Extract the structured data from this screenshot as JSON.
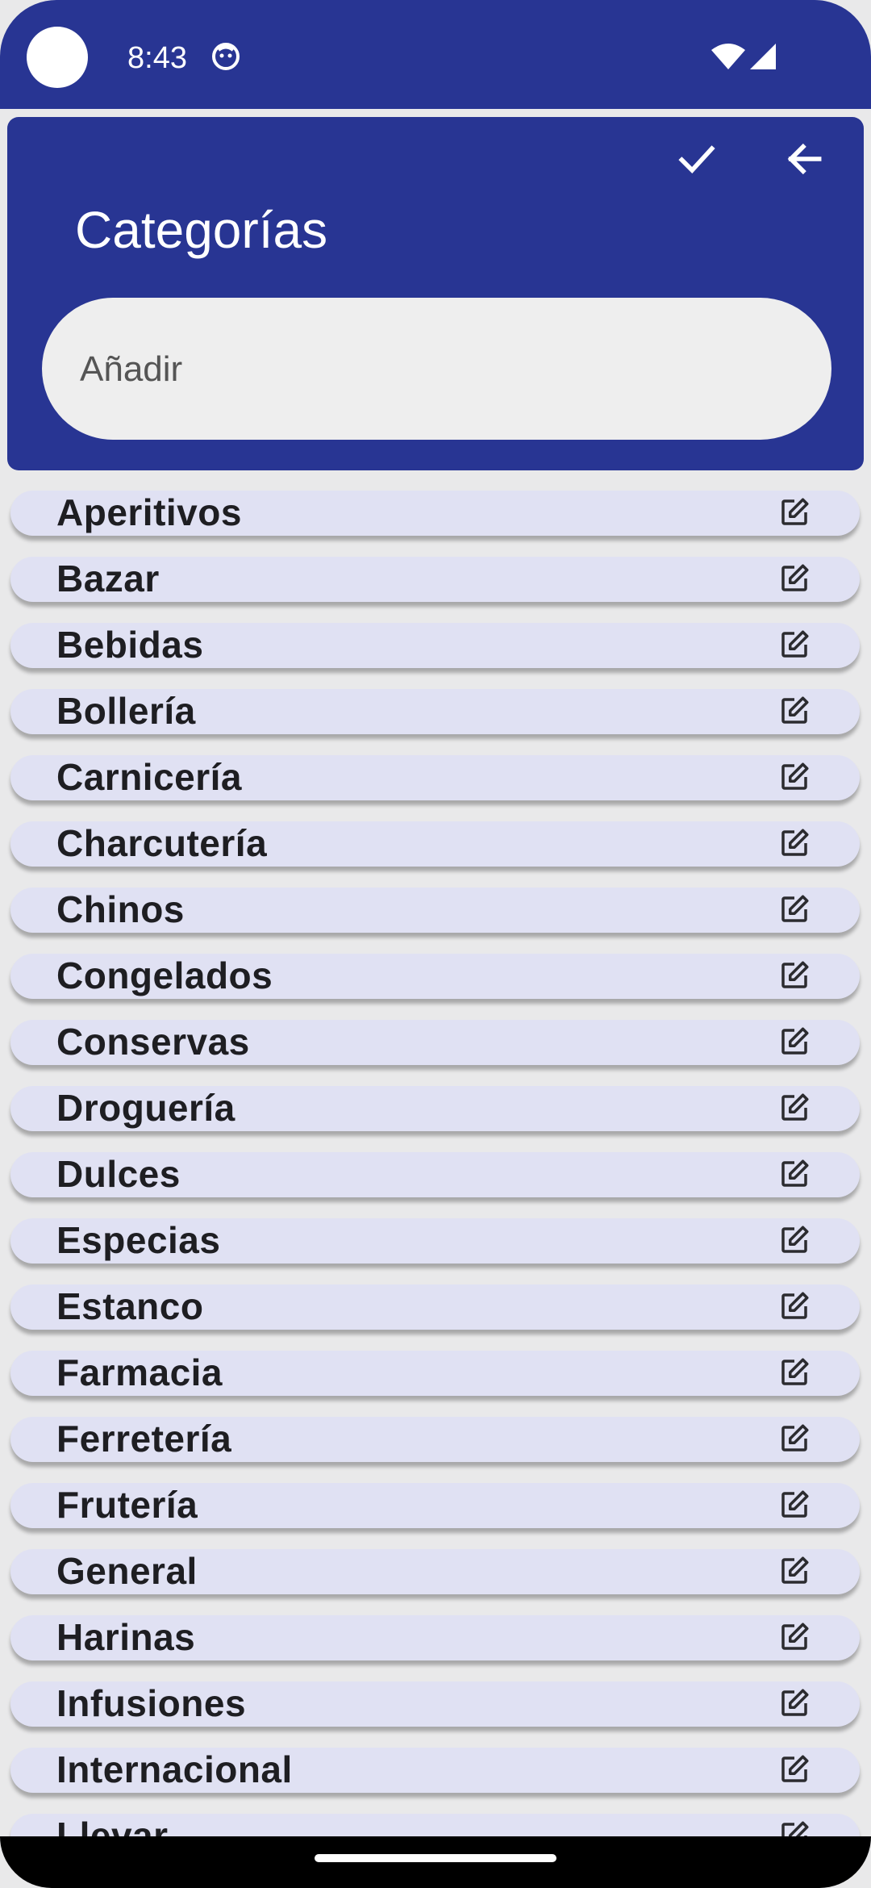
{
  "status_bar": {
    "time": "8:43"
  },
  "header": {
    "title": "Categorías",
    "confirm_icon": "check-icon",
    "back_icon": "arrow-back-icon"
  },
  "add_input": {
    "placeholder": "Añadir",
    "value": ""
  },
  "categories": [
    {
      "label": "Aperitivos"
    },
    {
      "label": "Bazar"
    },
    {
      "label": "Bebidas"
    },
    {
      "label": "Bollería"
    },
    {
      "label": "Carnicería"
    },
    {
      "label": "Charcutería"
    },
    {
      "label": "Chinos"
    },
    {
      "label": "Congelados"
    },
    {
      "label": "Conservas"
    },
    {
      "label": "Droguería"
    },
    {
      "label": "Dulces"
    },
    {
      "label": "Especias"
    },
    {
      "label": "Estanco"
    },
    {
      "label": "Farmacia"
    },
    {
      "label": "Ferretería"
    },
    {
      "label": "Frutería"
    },
    {
      "label": "General"
    },
    {
      "label": "Harinas"
    },
    {
      "label": "Infusiones"
    },
    {
      "label": "Internacional"
    },
    {
      "label": "Llevar"
    }
  ],
  "colors": {
    "primary": "#283593",
    "item_background": "#e0e1f3",
    "page_background": "#e9e9ea",
    "input_background": "#eeeeee"
  }
}
